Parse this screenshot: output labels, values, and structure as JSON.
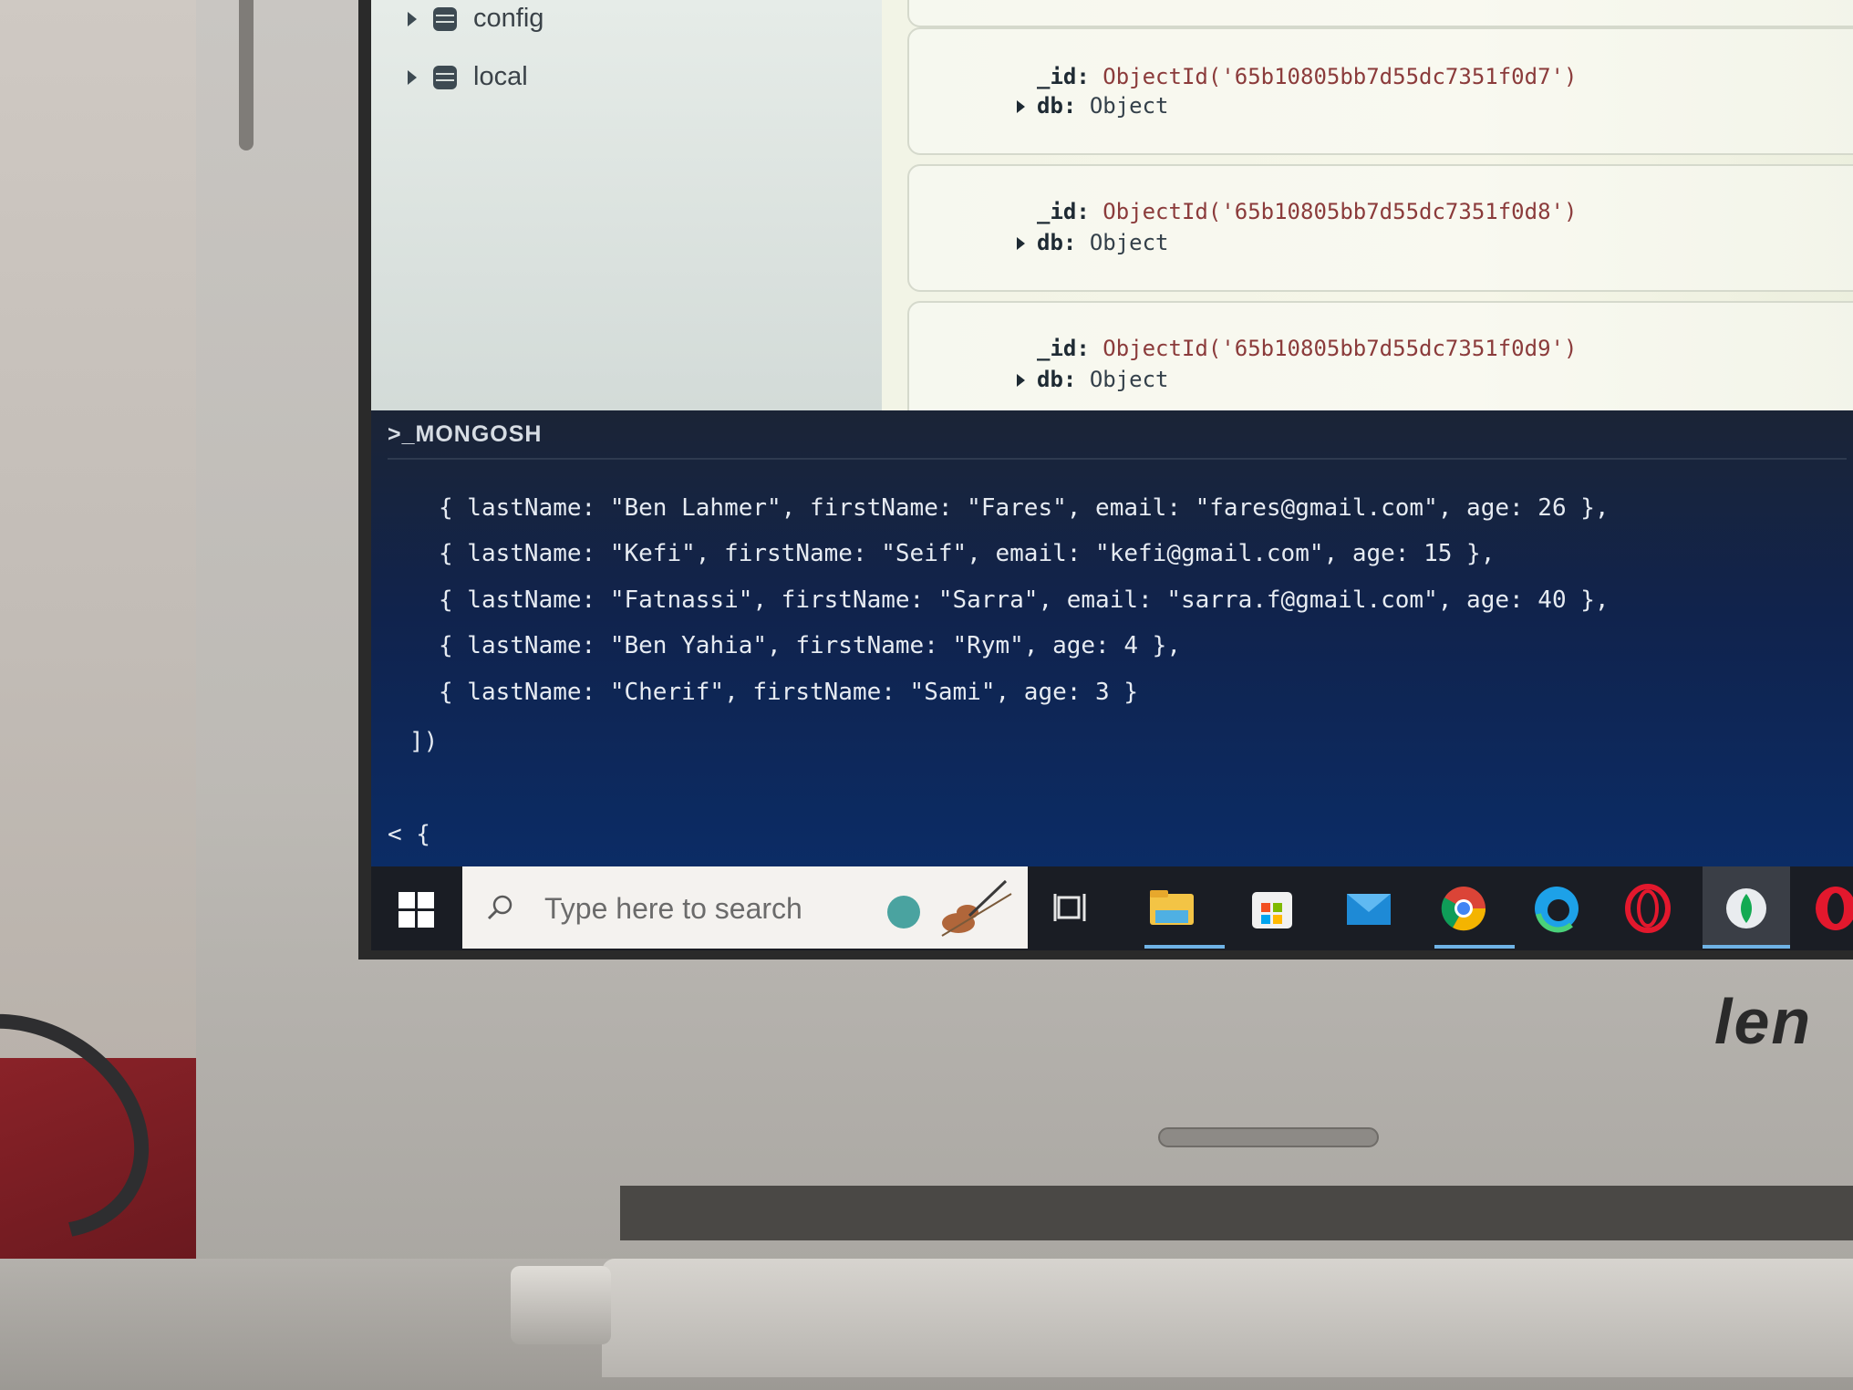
{
  "sidebar": {
    "databases": [
      {
        "name": "config"
      },
      {
        "name": "local"
      }
    ]
  },
  "documents": [
    {
      "id_key": "_id:",
      "id_value": "ObjectId('65b10805bb7d55dc7351f0d7')",
      "field_key": "db:",
      "field_value": "Object"
    },
    {
      "id_key": "_id:",
      "id_value": "ObjectId('65b10805bb7d55dc7351f0d8')",
      "field_key": "db:",
      "field_value": "Object"
    },
    {
      "id_key": "_id:",
      "id_value": "ObjectId('65b10805bb7d55dc7351f0d9')",
      "field_key": "db:",
      "field_value": "Object"
    }
  ],
  "shell": {
    "title": ">_MONGOSH",
    "lines": [
      "{ lastName: \"Ben Lahmer\", firstName: \"Fares\", email: \"fares@gmail.com\", age: 26 },",
      "{ lastName: \"Kefi\", firstName: \"Seif\", email: \"kefi@gmail.com\", age: 15 },",
      "{ lastName: \"Fatnassi\", firstName: \"Sarra\", email: \"sarra.f@gmail.com\", age: 40 },",
      "{ lastName: \"Ben Yahia\", firstName: \"Rym\", age: 4 },",
      "{ lastName: \"Cherif\", firstName: \"Sami\", age: 3 }"
    ],
    "closing": "])",
    "output_start": "< {"
  },
  "taskbar": {
    "search_placeholder": "Type here to search",
    "icons": [
      "start-windows-icon",
      "task-view-icon",
      "file-explorer-icon",
      "microsoft-store-icon",
      "mail-icon",
      "chrome-icon",
      "edge-icon",
      "opera-icon",
      "mongodb-compass-icon",
      "opera-gx-icon"
    ]
  },
  "colors": {
    "shell_bg": "#0b2c66",
    "doc_value": "#8b3b3b",
    "taskbar_bg": "#1a1d24",
    "active_underline": "#6fb3e6"
  }
}
